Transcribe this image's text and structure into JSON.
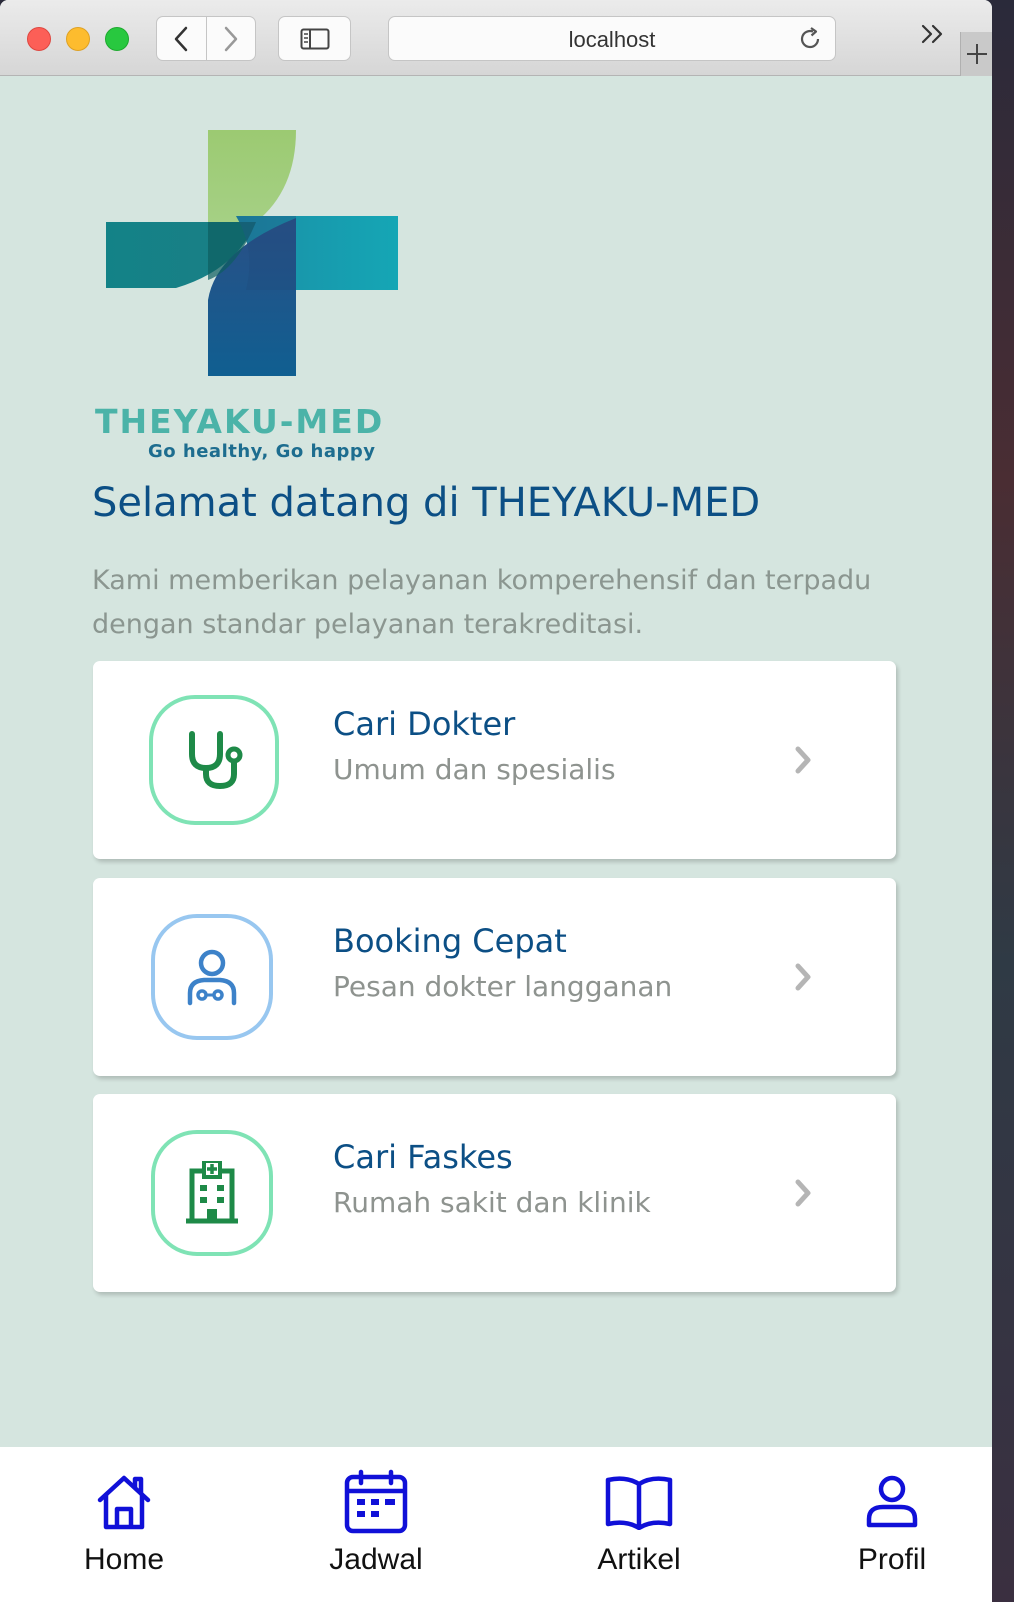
{
  "browser": {
    "url": "localhost"
  },
  "brand": {
    "name": "THEYAKU-MED",
    "tagline": "Go healthy, Go happy"
  },
  "hero": {
    "welcome": "Selamat datang di THEYAKU-MED",
    "description": "Kami memberikan pelayanan komperehensif dan terpadu dengan standar pelayanan terakreditasi."
  },
  "menu": [
    {
      "title": "Cari Dokter",
      "subtitle": "Umum dan spesialis",
      "icon": "stethoscope-icon"
    },
    {
      "title": "Booking Cepat",
      "subtitle": "Pesan dokter langganan",
      "icon": "doctor-icon"
    },
    {
      "title": "Cari Faskes",
      "subtitle": "Rumah sakit dan klinik",
      "icon": "hospital-icon"
    }
  ],
  "tabs": [
    {
      "label": "Home",
      "icon": "home-icon"
    },
    {
      "label": "Jadwal",
      "icon": "calendar-icon"
    },
    {
      "label": "Artikel",
      "icon": "book-icon"
    },
    {
      "label": "Profil",
      "icon": "user-icon"
    }
  ],
  "colors": {
    "page_bg": "#d5e5df",
    "primary_text": "#0c4f85",
    "muted_text": "#8b9690",
    "green_accent": "#1e8a48",
    "blue_accent": "#3d82c9",
    "tab_icon": "#1010d8"
  }
}
